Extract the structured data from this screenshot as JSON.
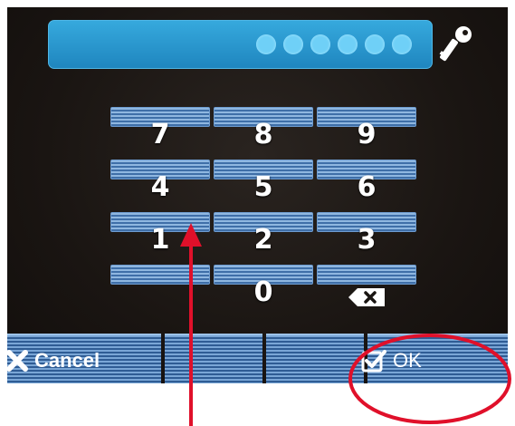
{
  "password": {
    "dot_count": 6
  },
  "keypad": {
    "keys": [
      {
        "label": "7",
        "row": 0,
        "col": 0
      },
      {
        "label": "8",
        "row": 0,
        "col": 1
      },
      {
        "label": "9",
        "row": 0,
        "col": 2
      },
      {
        "label": "4",
        "row": 1,
        "col": 0
      },
      {
        "label": "5",
        "row": 1,
        "col": 1
      },
      {
        "label": "6",
        "row": 1,
        "col": 2
      },
      {
        "label": "1",
        "row": 2,
        "col": 0
      },
      {
        "label": "2",
        "row": 2,
        "col": 1
      },
      {
        "label": "3",
        "row": 2,
        "col": 2
      },
      {
        "label": "",
        "row": 3,
        "col": 0
      },
      {
        "label": "0",
        "row": 3,
        "col": 1
      },
      {
        "label": "",
        "row": 3,
        "col": 2,
        "icon": "backspace-icon"
      }
    ]
  },
  "softkeys": {
    "cancel_label": "Cancel",
    "ok_label": "OK"
  },
  "colors": {
    "password_bar": "#2a9ad3",
    "key_stripe": "#5f8fc4",
    "annotation": "#e0102a"
  },
  "icons": {
    "password": "key-icon",
    "cancel": "close-icon",
    "ok": "checkbox-icon",
    "delete": "backspace-icon"
  }
}
